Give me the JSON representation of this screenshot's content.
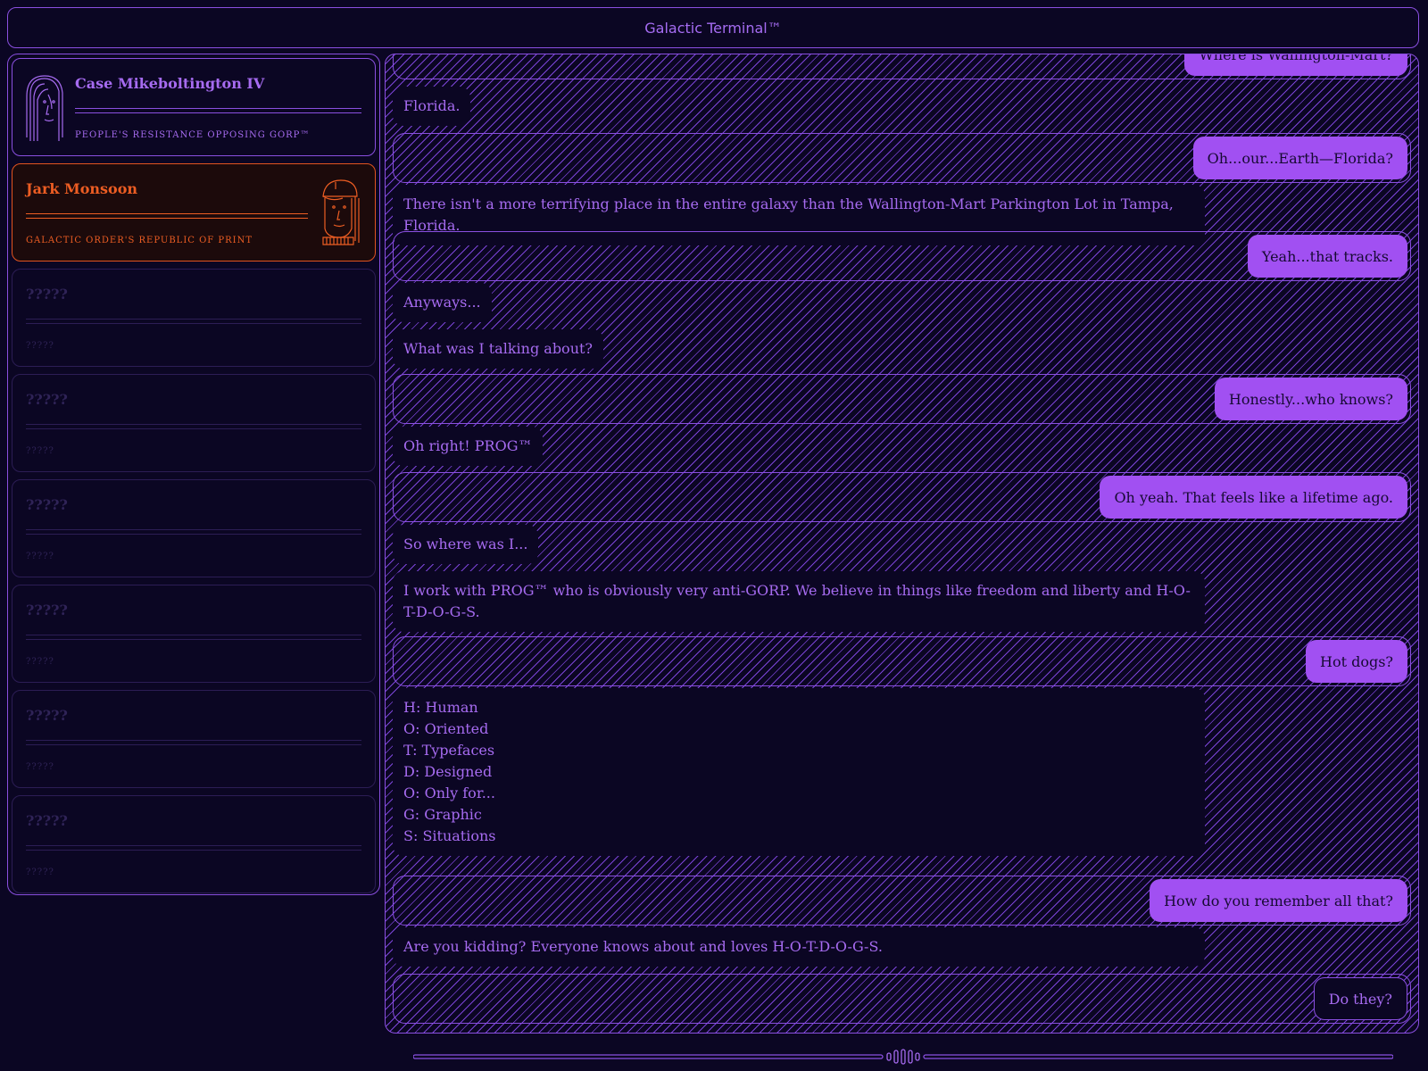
{
  "window": {
    "title": "Galactic Terminal™"
  },
  "colors": {
    "accent": "#a150f2",
    "background": "#0b0623",
    "orange": "#ec5d23"
  },
  "contacts": [
    {
      "name": "Case Mikeboltington IV",
      "org": "PEOPLE'S RESISTANCE OPPOSING GORP™",
      "state": "purple"
    },
    {
      "name": "Jark Monsoon",
      "org": "GALACTIC ORDER'S REPUBLIC OF PRINT",
      "state": "orange-selected"
    },
    {
      "name": "?????",
      "org": "?????"
    },
    {
      "name": "?????",
      "org": "?????"
    },
    {
      "name": "?????",
      "org": "?????"
    },
    {
      "name": "?????",
      "org": "?????"
    },
    {
      "name": "?????",
      "org": "?????"
    },
    {
      "name": "?????",
      "org": "?????"
    }
  ],
  "messages": [
    {
      "from": "me",
      "text": "Where is Wallington-Mart?"
    },
    {
      "from": "them",
      "text": "Florida."
    },
    {
      "from": "me",
      "text": "Oh...our...Earth—Florida?"
    },
    {
      "from": "them",
      "text": "There isn't a more terrifying place in the entire galaxy than the Wallington-Mart Parkington Lot in Tampa, Florida."
    },
    {
      "from": "me",
      "text": "Yeah...that tracks."
    },
    {
      "from": "them",
      "text": "Anyways..."
    },
    {
      "from": "them",
      "text": "What was I talking about?"
    },
    {
      "from": "me",
      "text": "Honestly...who knows?"
    },
    {
      "from": "them",
      "text": "Oh right! PROG™"
    },
    {
      "from": "me",
      "text": "Oh yeah. That feels like a lifetime ago."
    },
    {
      "from": "them",
      "text": "So where was I..."
    },
    {
      "from": "them",
      "text": "I work with PROG™ who is obviously very anti-GORP. We believe in things like freedom and liberty and H-O-T-D-O-G-S."
    },
    {
      "from": "me",
      "text": "Hot dogs?"
    },
    {
      "from": "them",
      "lines": [
        "H: Human",
        "O: Oriented",
        "T: Typefaces",
        "D: Designed",
        "O: Only for...",
        "G: Graphic",
        "S: Situations"
      ]
    },
    {
      "from": "me",
      "text": "How do you remember all that?"
    },
    {
      "from": "them",
      "text": "Are you kidding? Everyone knows about and loves H-O-T-D-O-G-S."
    },
    {
      "from": "me",
      "text": "Do they?",
      "style": "outline"
    }
  ]
}
